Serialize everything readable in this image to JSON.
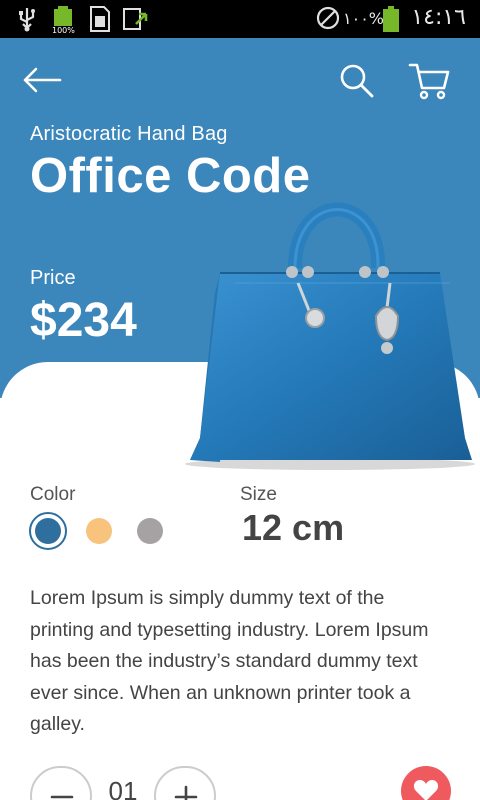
{
  "status_bar": {
    "battery_percent": "١٠٠%",
    "small_battery_label": "100%",
    "time": "١٤:١٦"
  },
  "header": {
    "back_icon": "back-arrow-icon",
    "search_icon": "search-icon",
    "cart_icon": "cart-icon"
  },
  "product": {
    "subtitle": "Aristocratic Hand Bag",
    "title": "Office Code",
    "price_label": "Price",
    "price": "$234",
    "color_label": "Color",
    "colors": [
      "#2f6f9f",
      "#f8c37c",
      "#a6a2a3"
    ],
    "selected_color": "#2f6f9f",
    "size_label": "Size",
    "size": "12 cm",
    "description": "Lorem Ipsum is simply dummy text of the printing and typesetting industry. Lorem Ipsum has been the industry’s standard dummy text ever since. When an unknown printer took a galley."
  },
  "quantity": {
    "value": "01",
    "minus_icon": "minus-icon",
    "plus_icon": "plus-icon"
  },
  "favorite": {
    "icon": "heart-icon",
    "color": "#ef5a5e"
  },
  "colors": {
    "accent": "#3b86bb"
  }
}
